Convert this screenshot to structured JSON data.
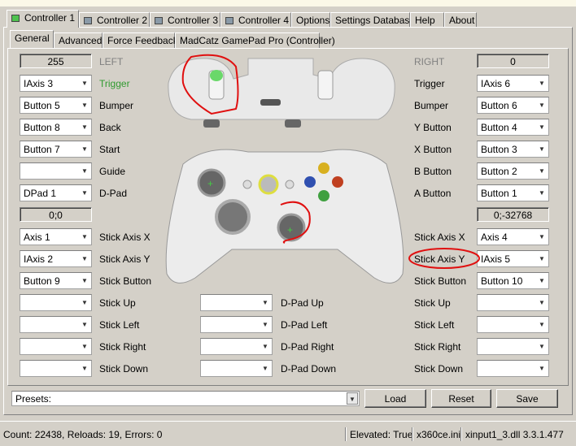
{
  "controller_tabs": [
    {
      "label": "Controller 1",
      "led": "on"
    },
    {
      "label": "Controller 2",
      "led": "off"
    },
    {
      "label": "Controller 3",
      "led": "off"
    },
    {
      "label": "Controller 4",
      "led": "off"
    },
    {
      "label": "Options"
    },
    {
      "label": "Settings Database"
    },
    {
      "label": "Help"
    },
    {
      "label": "About"
    }
  ],
  "sub_tabs": [
    "General",
    "Advanced",
    "Force Feedback",
    "MadCatz GamePad Pro (Controller)"
  ],
  "left": {
    "value": "255",
    "heading": "LEFT",
    "stick_value": "0;0",
    "rows": [
      {
        "label": "Trigger",
        "value": "IAxis 3",
        "active": true
      },
      {
        "label": "Bumper",
        "value": "Button 5"
      },
      {
        "label": "Back",
        "value": "Button 8"
      },
      {
        "label": "Start",
        "value": "Button 7"
      },
      {
        "label": "Guide",
        "value": ""
      },
      {
        "label": "D-Pad",
        "value": "DPad 1"
      }
    ],
    "stick_rows": [
      {
        "label": "Stick Axis X",
        "value": "Axis 1"
      },
      {
        "label": "Stick Axis Y",
        "value": "IAxis 2"
      },
      {
        "label": "Stick Button",
        "value": "Button 9"
      },
      {
        "label": "Stick Up",
        "value": ""
      },
      {
        "label": "Stick Left",
        "value": ""
      },
      {
        "label": "Stick Right",
        "value": ""
      },
      {
        "label": "Stick Down",
        "value": ""
      }
    ]
  },
  "right": {
    "value": "0",
    "heading": "RIGHT",
    "stick_value": "0;-32768",
    "rows": [
      {
        "label": "Trigger",
        "value": "IAxis 6"
      },
      {
        "label": "Bumper",
        "value": "Button 6"
      },
      {
        "label": "Y Button",
        "value": "Button 4"
      },
      {
        "label": "X Button",
        "value": "Button 3"
      },
      {
        "label": "B Button",
        "value": "Button 2"
      },
      {
        "label": "A Button",
        "value": "Button 1"
      }
    ],
    "stick_rows": [
      {
        "label": "Stick Axis X",
        "value": "Axis 4"
      },
      {
        "label": "Stick Axis Y",
        "value": "IAxis 5"
      },
      {
        "label": "Stick Button",
        "value": "Button 10"
      },
      {
        "label": "Stick Up",
        "value": ""
      },
      {
        "label": "Stick Left",
        "value": ""
      },
      {
        "label": "Stick Right",
        "value": ""
      },
      {
        "label": "Stick Down",
        "value": ""
      }
    ]
  },
  "dpad_rows": [
    {
      "label": "D-Pad Up",
      "value": ""
    },
    {
      "label": "D-Pad Left",
      "value": ""
    },
    {
      "label": "D-Pad Right",
      "value": ""
    },
    {
      "label": "D-Pad Down",
      "value": ""
    }
  ],
  "presets": {
    "value": "Presets:"
  },
  "buttons": {
    "load": "Load",
    "reset": "Reset",
    "save": "Save"
  },
  "status": {
    "counts": "Count: 22438, Reloads: 19, Errors: 0",
    "elevated": "Elevated: True",
    "ini": "x360ce.ini",
    "dll": "xinput1_3.dll 3.3.1.477"
  },
  "colors": {
    "active_label": "#2f9a2f",
    "heading": "#808080",
    "annotation": "#e01010"
  }
}
